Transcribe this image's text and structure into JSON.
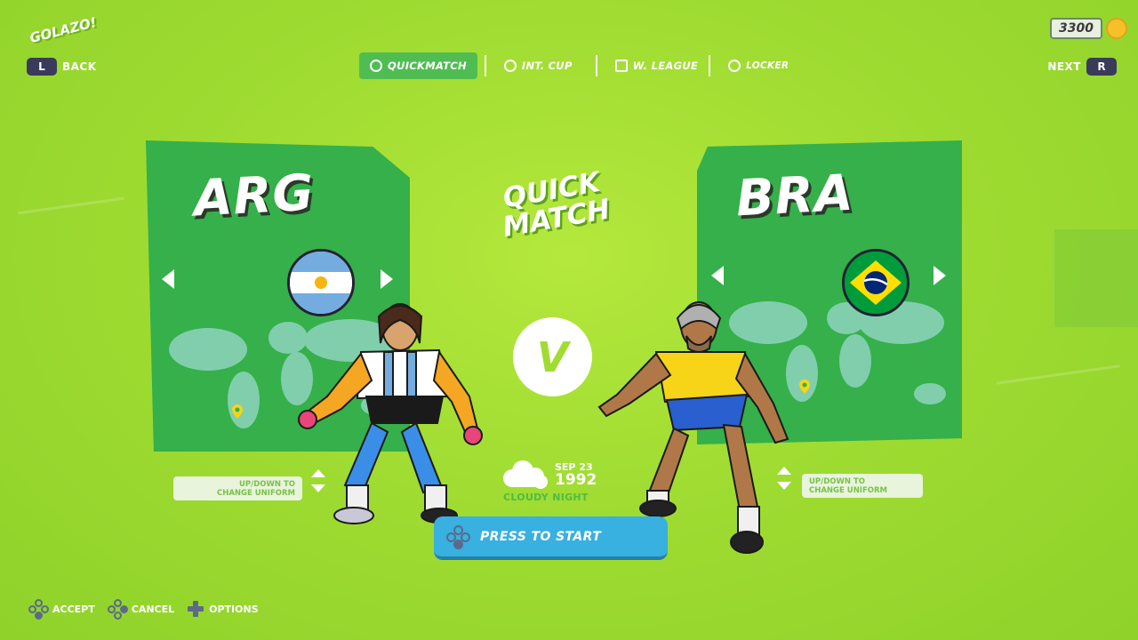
{
  "header": {
    "logo_text": "GOLAZO!",
    "back": {
      "key": "L",
      "label": "BACK"
    },
    "next": {
      "key": "R",
      "label": "NEXT"
    },
    "coins": "3300"
  },
  "tabs": [
    {
      "label": "QUICKMATCH",
      "icon": "ball-icon",
      "active": true
    },
    {
      "label": "INT. CUP",
      "icon": "globe-icon",
      "active": false
    },
    {
      "label": "W. LEAGUE",
      "icon": "league-icon",
      "active": false
    },
    {
      "label": "LOCKER",
      "icon": "locker-icon",
      "active": false
    }
  ],
  "home_team": {
    "code": "ARG",
    "flag": "argentina",
    "colors": {
      "primary": "#74acdf",
      "sun": "#f6b40e"
    }
  },
  "away_team": {
    "code": "BRA",
    "flag": "brazil",
    "colors": {
      "green": "#009c3b",
      "yellow": "#ffdf00",
      "blue": "#002776"
    }
  },
  "center": {
    "title_line1": "QUICK",
    "title_line2": "MATCH",
    "vs_letter": "V"
  },
  "uniform_hint": {
    "line1": "UP/DOWN TO",
    "line2": "CHANGE UNIFORM"
  },
  "match_info": {
    "date": "SEP 23",
    "year": "1992",
    "condition": "CLOUDY NIGHT",
    "weather_icon": "cloud-icon"
  },
  "start_button": {
    "label": "PRESS TO START"
  },
  "footer": [
    {
      "label": "ACCEPT",
      "icon": "button-icon"
    },
    {
      "label": "CANCEL",
      "icon": "button-icon"
    },
    {
      "label": "OPTIONS",
      "icon": "dpad-icon"
    }
  ],
  "colors": {
    "background": "#a0dc32",
    "panel": "#35b04a",
    "start_button": "#38b0e0",
    "coin": "#f7c02a"
  }
}
